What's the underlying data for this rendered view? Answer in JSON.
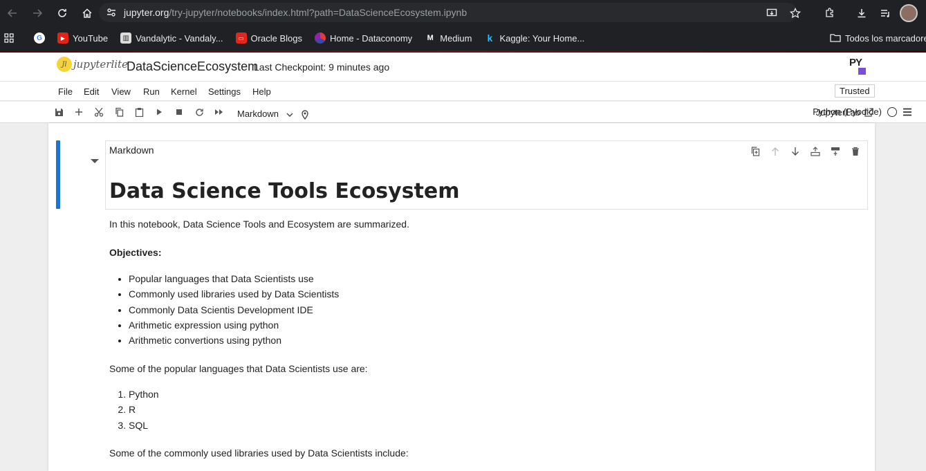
{
  "browser": {
    "url_domain": "jupyter.org",
    "url_path": "/try-jupyter/notebooks/index.html?path=DataScienceEcosystem.ipynb",
    "bookmarks": [
      {
        "label": "",
        "icon": "google-icon"
      },
      {
        "label": "YouTube",
        "icon": "youtube-icon"
      },
      {
        "label": "Vandalytic - Vandaly...",
        "icon": "vandalytic-icon"
      },
      {
        "label": "Oracle Blogs",
        "icon": "oracle-icon"
      },
      {
        "label": "Home - Dataconomy",
        "icon": "dataconomy-icon"
      },
      {
        "label": "Medium",
        "icon": "medium-icon"
      },
      {
        "label": "Kaggle: Your Home...",
        "icon": "kaggle-icon"
      }
    ],
    "all_bookmarks": "Todos los marcadores"
  },
  "jupyter": {
    "logo_text": "jupyterlite",
    "notebook_title": "DataScienceEcosystem",
    "checkpoint": "Last Checkpoint: 9 minutes ago",
    "py_logo": "PY",
    "menu": [
      "File",
      "Edit",
      "View",
      "Run",
      "Kernel",
      "Settings",
      "Help"
    ],
    "trusted": "Trusted",
    "cell_type": "Markdown",
    "jupyterlab_link": "JupyterLab",
    "kernel_name": "Python (Pyodide)"
  },
  "cell": {
    "editor_label": "Markdown",
    "heading": "Data Science Tools Ecosystem",
    "intro": "In this notebook, Data Science Tools and Ecosystem are summarized.",
    "objectives_label": "Objectives:",
    "objectives": [
      "Popular languages that Data Scientists use",
      "Commonly used libraries used by Data Scientists",
      "Commonly Data Scientis Development IDE",
      "Arithmetic expression using python",
      "Arithmetic convertions using python"
    ],
    "languages_intro": "Some of the popular languages that Data Scientists use are:",
    "languages": [
      "Python",
      "R",
      "SQL"
    ],
    "libraries_intro": "Some of the commonly used libraries used by Data Scientists include:"
  }
}
